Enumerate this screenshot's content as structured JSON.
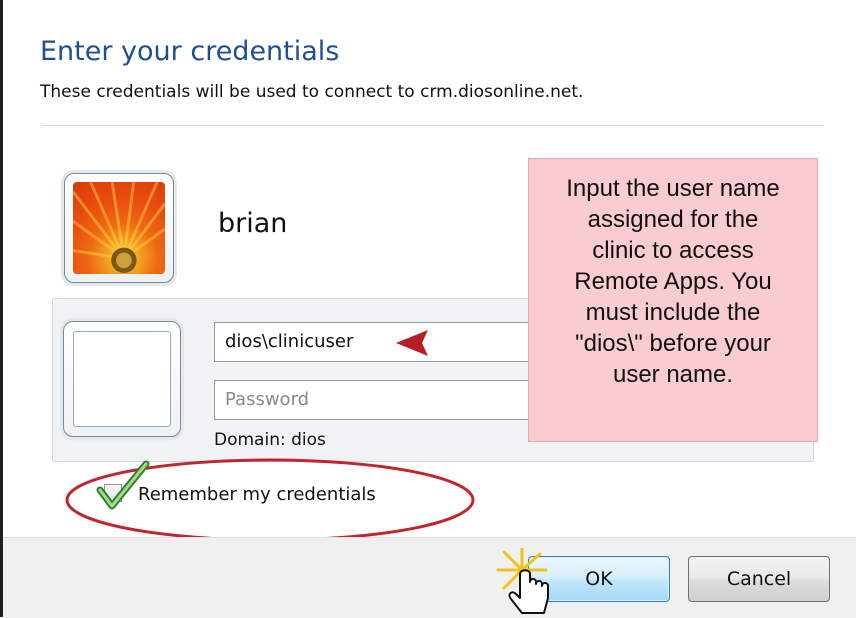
{
  "dialog": {
    "title": "Enter your credentials",
    "subtitle": "These credentials will be used to connect to crm.diosonline.net."
  },
  "account": {
    "username": "brian",
    "tile_icon": "flower-user-picture"
  },
  "credentials": {
    "username_value": "dios\\clinicuser",
    "password_placeholder": "Password",
    "domain_text": "Domain: dios",
    "blank_tile_icon": "blank-user-tile"
  },
  "remember": {
    "label": "Remember my credentials",
    "checked": true
  },
  "callout": {
    "text": "Input the user name\nassigned for the\nclinic to access\nRemote Apps.  You\nmust include the\n\"dios\\\" before your\nuser name.",
    "background": "#f8ccd0"
  },
  "annotations": {
    "arrow_color": "#c0262e",
    "ellipse_color": "#c0262e",
    "cursor_icon": "hand-pointer-icon"
  },
  "buttons": {
    "ok_label": "OK",
    "cancel_label": "Cancel"
  },
  "colors": {
    "title": "#1e4f95",
    "ok_border": "#3c7fb1"
  }
}
